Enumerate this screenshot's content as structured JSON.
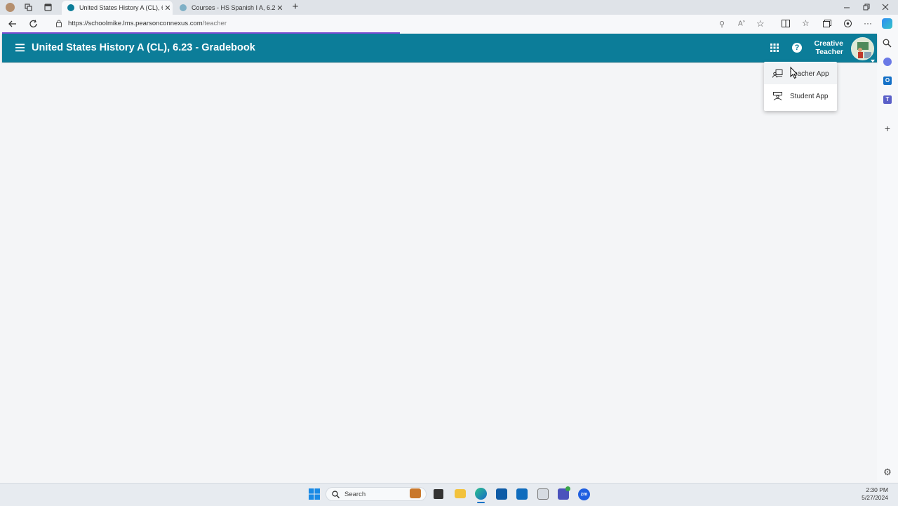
{
  "browser": {
    "tabs": [
      {
        "title": "United States History A (CL), 6.23",
        "active": true
      },
      {
        "title": "Courses - HS Spanish I A, 6.23",
        "active": false
      }
    ],
    "url_host": "https://schoolmike.lms.pearsonconnexus.com",
    "url_path": "/teacher"
  },
  "header": {
    "menu_icon": "hamburger-icon",
    "title": "United States History A (CL), 6.23 - Gradebook",
    "user_first": "Creative",
    "user_last": "Teacher",
    "brand_color": "#0c7d99"
  },
  "app_menu": {
    "items": [
      {
        "label": "Teacher App",
        "icon": "teacher-app-icon"
      },
      {
        "label": "Student App",
        "icon": "student-app-icon"
      }
    ]
  },
  "taskbar": {
    "search_label": "Search",
    "time": "2:30 PM",
    "date": "5/27/2024"
  }
}
